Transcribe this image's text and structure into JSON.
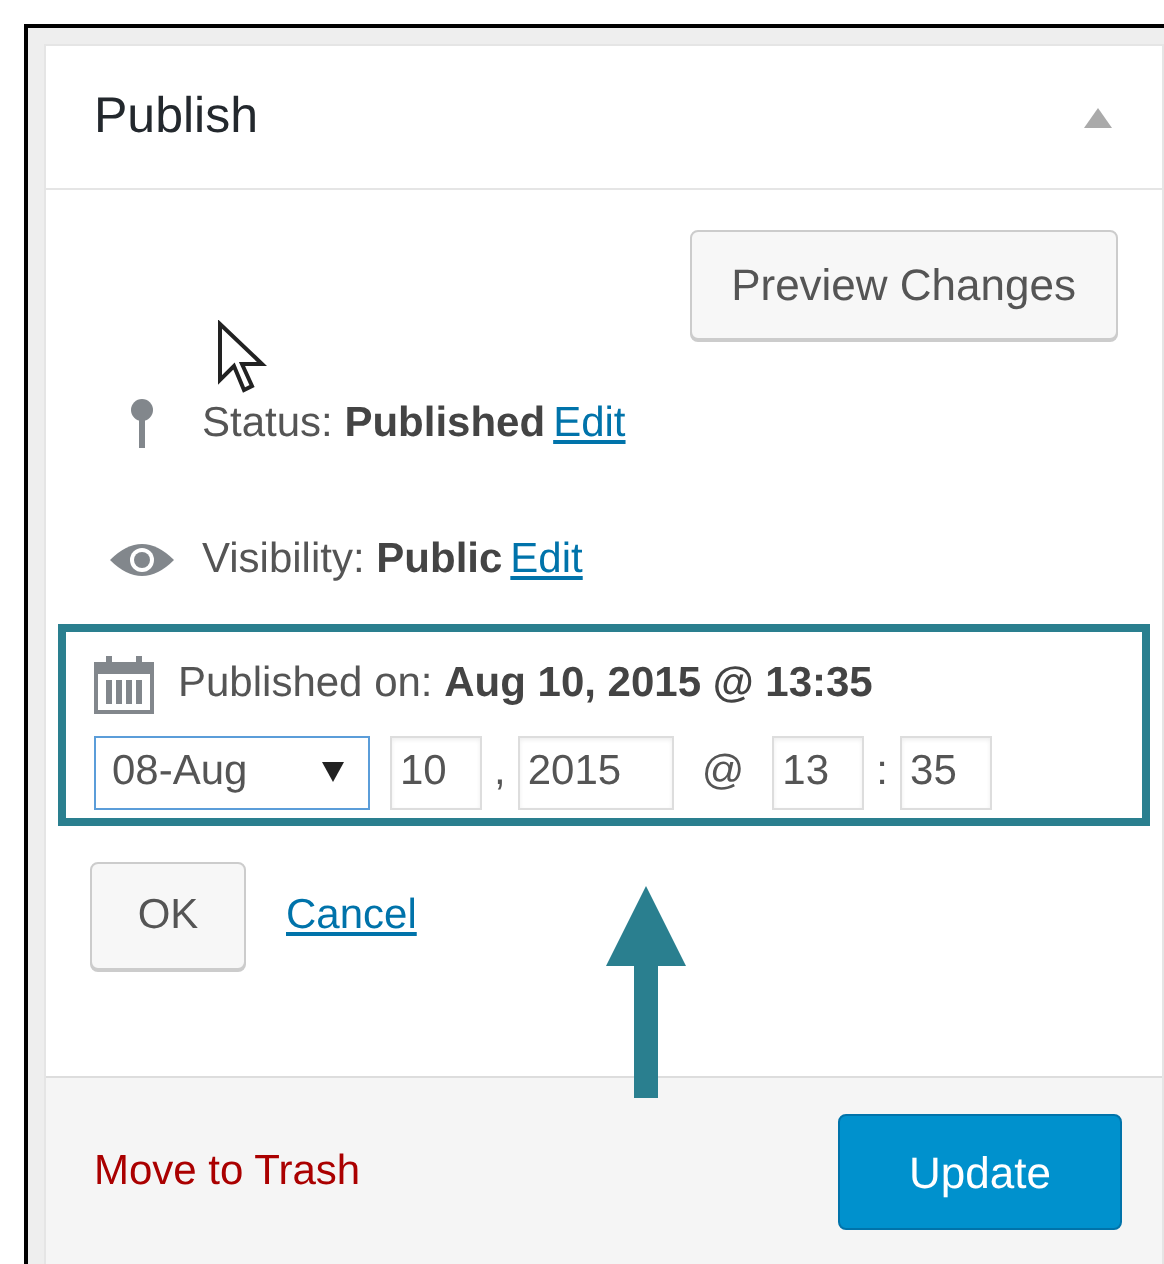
{
  "panel": {
    "title": "Publish",
    "collapsed": false
  },
  "preview_button": "Preview Changes",
  "rows": [
    {
      "kind": "pin",
      "label": "Status:",
      "value": "Published",
      "link": "Edit"
    },
    {
      "kind": "eye",
      "label": "Visibility:",
      "value": "Public",
      "link": "Edit"
    }
  ],
  "schedule": {
    "highlighted": true,
    "label": "Published on:",
    "value": "Aug 10, 2015 @ 13:35",
    "month": "08-Aug",
    "day": "10",
    "sep1": ",",
    "year": "2015",
    "at": "@",
    "hour": "13",
    "sep2": ":",
    "minute": "35"
  },
  "ok_button": "OK",
  "cancel_link": "Cancel",
  "trash_link": "Move to Trash",
  "update_button": "Update"
}
